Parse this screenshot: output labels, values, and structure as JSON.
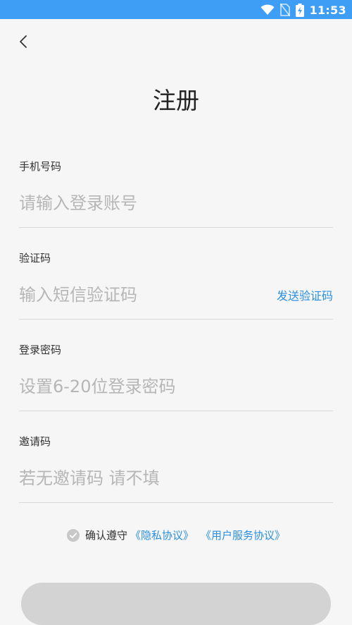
{
  "status_bar": {
    "time": "11:53",
    "icons": [
      "wifi-icon",
      "no-sim-icon",
      "battery-charging-icon"
    ],
    "background": "#3e9ef6"
  },
  "header": {
    "back_icon": "chevron-left-icon",
    "title": "注册"
  },
  "form": {
    "phone": {
      "label": "手机号码",
      "placeholder": "请输入登录账号",
      "value": ""
    },
    "code": {
      "label": "验证码",
      "placeholder": "输入短信验证码",
      "value": "",
      "send_label": "发送验证码"
    },
    "password": {
      "label": "登录密码",
      "placeholder": "设置6-20位登录密码",
      "value": ""
    },
    "invite": {
      "label": "邀请码",
      "placeholder": "若无邀请码 请不填",
      "value": ""
    }
  },
  "agreement": {
    "checked": false,
    "text": "确认遵守",
    "privacy_link": "《隐私协议》",
    "service_link": "《用户服务协议》"
  },
  "colors": {
    "accent": "#2a8fe0",
    "placeholder": "#b6b6b6",
    "divider": "#d9d9d9",
    "button_disabled": "#d3d3d3"
  }
}
